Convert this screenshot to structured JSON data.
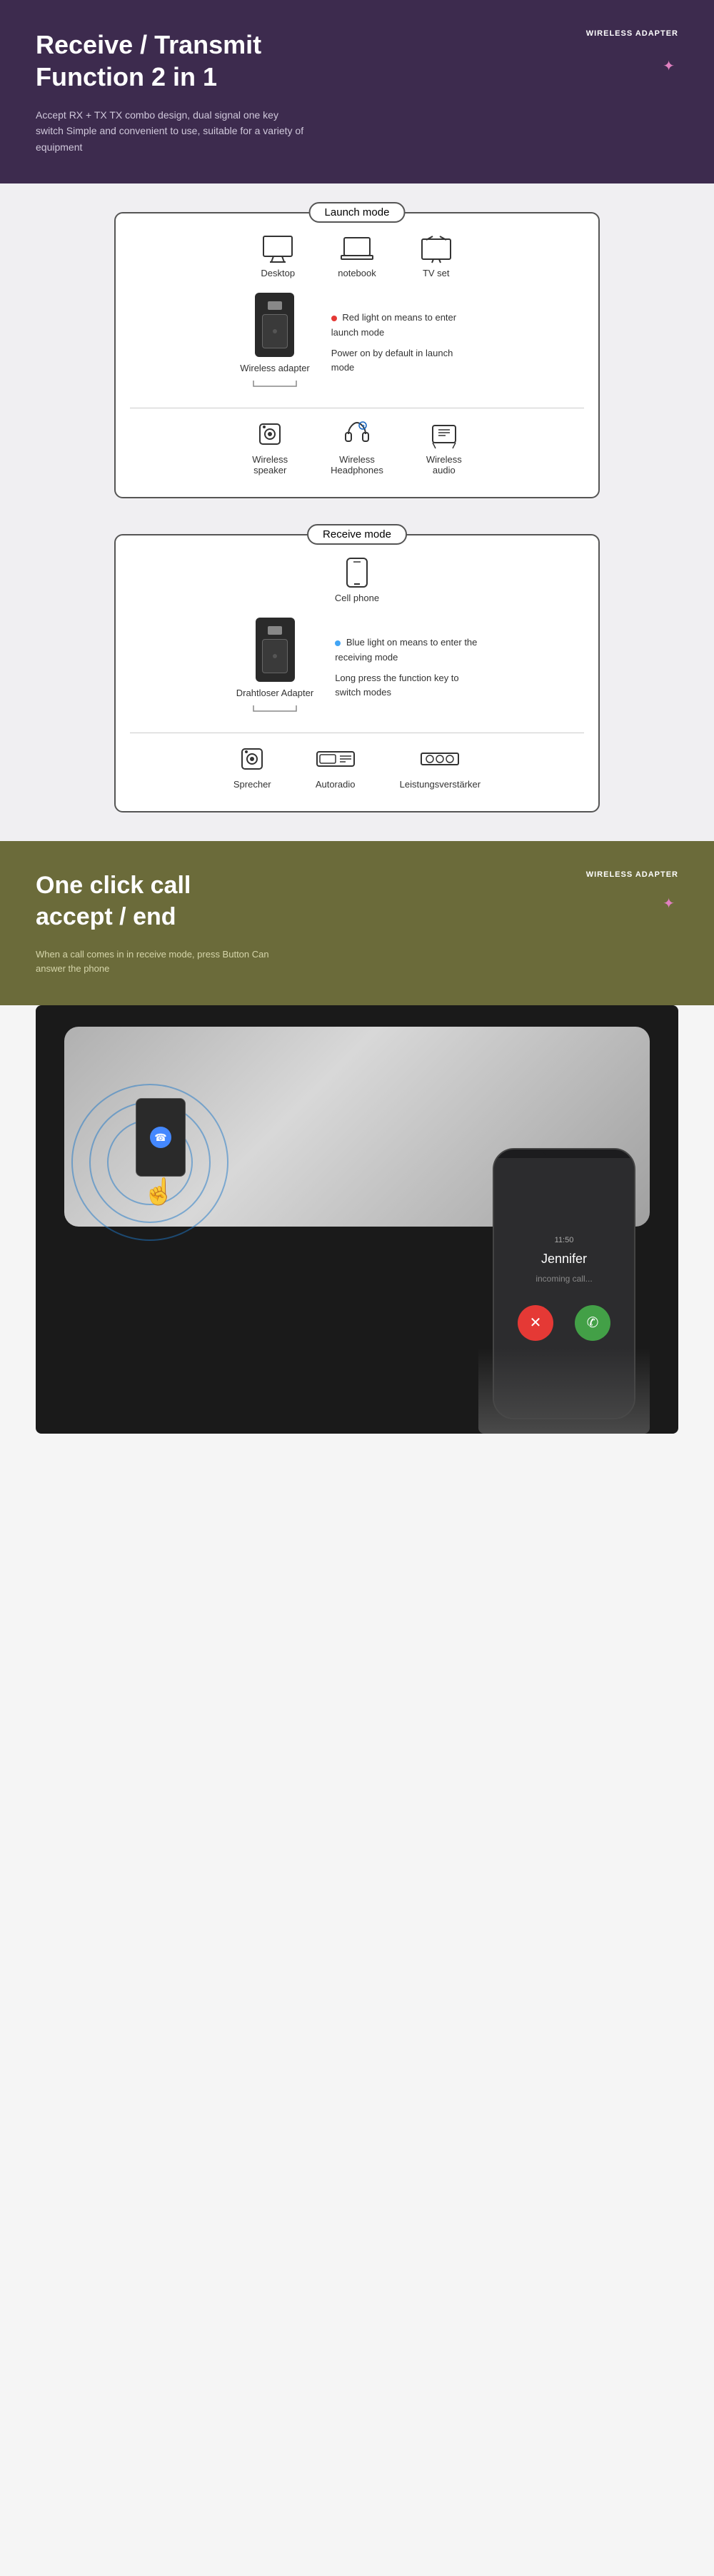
{
  "header": {
    "badge": "WIRELESS\nADAPTER",
    "title_line1": "Receive / Transmit",
    "title_line2": "Function 2 in 1",
    "description": "Accept RX + TX TX combo design, dual signal one key switch\nSimple and convenient to use, suitable for a variety of equipment"
  },
  "launch_section": {
    "title": "Launch mode",
    "top_icons": [
      {
        "label": "Desktop",
        "icon": "desktop"
      },
      {
        "label": "notebook",
        "icon": "laptop"
      },
      {
        "label": "TV set",
        "icon": "tv"
      }
    ],
    "device_label": "Wireless adapter",
    "info_line1": "Red light on means to enter launch mode",
    "info_line2": "Power on by default in launch mode",
    "bottom_icons": [
      {
        "label": "Wireless\nspeaker",
        "icon": "speaker"
      },
      {
        "label": "Wireless\nHeadphones",
        "icon": "headphones"
      },
      {
        "label": "Wireless\naudio",
        "icon": "audio"
      }
    ]
  },
  "receive_section": {
    "title": "Receive mode",
    "top_icons": [
      {
        "label": "Cell phone",
        "icon": "phone"
      }
    ],
    "device_label": "Drahtloser Adapter",
    "info_line1": "Blue light on means to enter the receiving mode",
    "info_line2": "Long press the function key to switch modes",
    "bottom_icons": [
      {
        "label": "Sprecher",
        "icon": "speaker"
      },
      {
        "label": "Autoradio",
        "icon": "radio"
      },
      {
        "label": "Leistungsverstärker",
        "icon": "amplifier"
      }
    ]
  },
  "call_section": {
    "badge": "WIRELESS\nADAPTER",
    "title_line1": "One click call",
    "title_line2": "accept / end",
    "description": "When a call comes in in receive mode, press\nButton Can answer the phone",
    "caller_name": "Jennifer"
  }
}
